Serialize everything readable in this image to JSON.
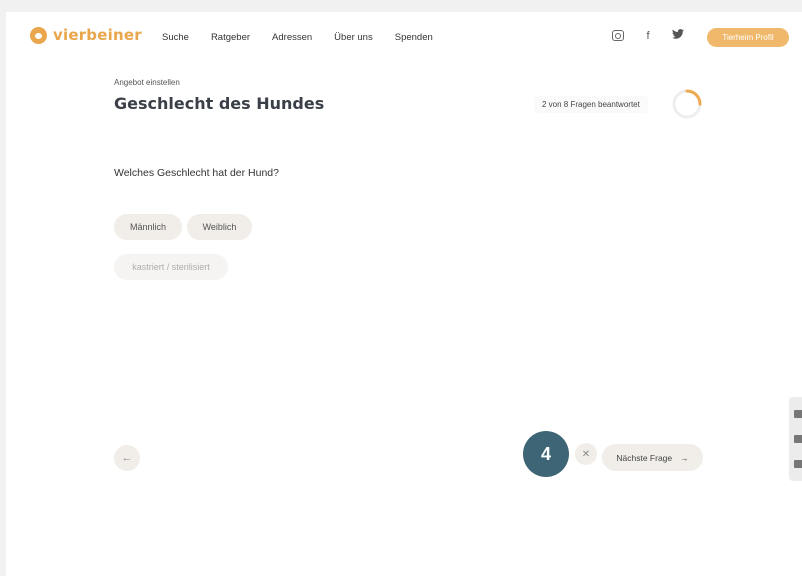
{
  "header": {
    "logo_text": "vierbeiner",
    "nav": [
      "Suche",
      "Ratgeber",
      "Adressen",
      "Über uns",
      "Spenden"
    ],
    "social_icons": [
      "instagram-icon",
      "facebook-icon",
      "twitter-icon"
    ],
    "profile_button": "Tierheim Profil"
  },
  "page": {
    "eyebrow": "Angebot einstellen",
    "title": "Geschlecht des Hundes",
    "progress_text": "2 von 8 Fragen beantwortet",
    "progress": {
      "answered": 2,
      "total": 8
    }
  },
  "question": {
    "text": "Welches Geschlecht hat der Hund?",
    "options": [
      "Männlich",
      "Weiblich",
      "kastriert / sterilisiert"
    ]
  },
  "footer": {
    "back_icon": "←",
    "step_badge": "4",
    "close_icon": "✕",
    "next_label": "Nächste Frage",
    "next_icon": "→"
  },
  "colors": {
    "accent": "#e9a64c",
    "badge": "#3e6575"
  }
}
